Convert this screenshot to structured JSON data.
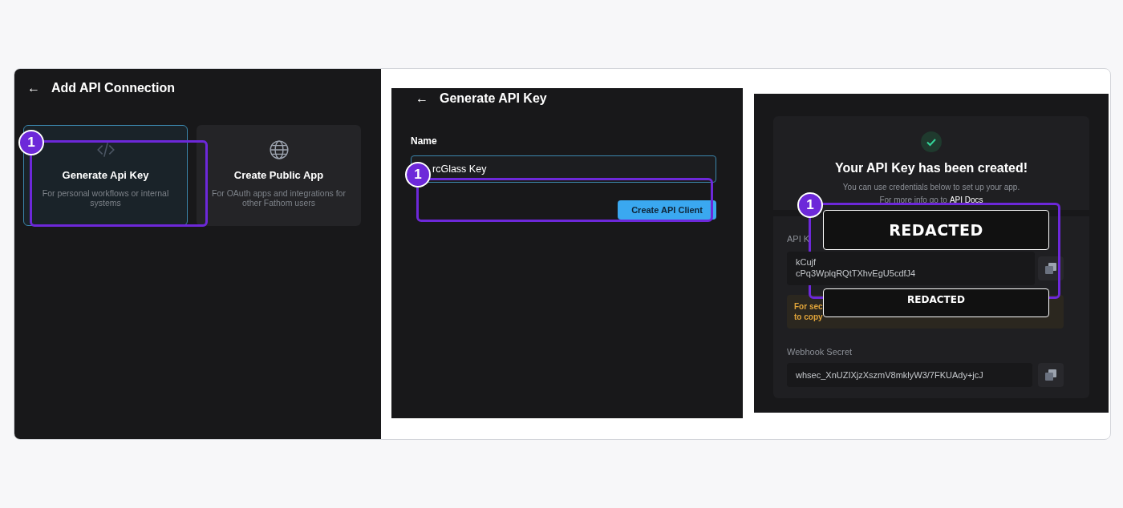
{
  "connection_panel": {
    "back": "←",
    "title": "Add API Connection",
    "options": [
      {
        "kind": "code",
        "title": "Generate Api Key",
        "description": "For personal workflows or internal systems",
        "selected": true
      },
      {
        "kind": "globe",
        "title": "Create Public App",
        "description": "For OAuth apps and integrations for other Fathom users",
        "selected": false
      }
    ],
    "step_badge": "1"
  },
  "generate_panel": {
    "back": "←",
    "title": "Generate API Key",
    "name_label": "Name",
    "name_value": "rcGlass Key",
    "button": "Create API Client",
    "step_badge": "1"
  },
  "created_panel": {
    "title": "Your API Key has been created!",
    "subtitle": "You can use credentials below to set up your app.",
    "docs_prefix": "For more info go to",
    "docs_link": "API Docs",
    "api_key_label": "API K",
    "api_key_lines": [
      "kCujf",
      "cPq3WplqRQtTXhvEgU5cdfJ4"
    ],
    "warning_lines": [
      "For sec",
      "to copy"
    ],
    "webhook_label": "Webhook Secret",
    "webhook_value": "whsec_XnUZIXjzXszmV8mklyW3/7FKUAdy+jcJ",
    "redactions": [
      "REDACTED",
      "REDACTED"
    ],
    "step_badge": "1"
  }
}
